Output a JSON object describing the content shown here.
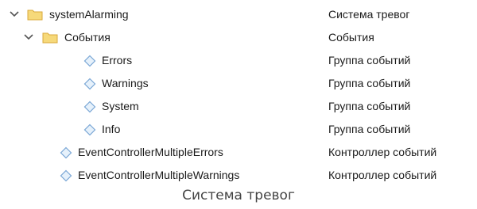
{
  "tree": {
    "root": {
      "name": "systemAlarming",
      "description": "Система тревог"
    },
    "events_folder": {
      "name": "События",
      "description": "События"
    },
    "event_groups": [
      {
        "name": "Errors",
        "description": "Группа событий"
      },
      {
        "name": "Warnings",
        "description": "Группа событий"
      },
      {
        "name": "System",
        "description": "Группа событий"
      },
      {
        "name": "Info",
        "description": "Группа событий"
      }
    ],
    "controllers": [
      {
        "name": "EventControllerMultipleErrors",
        "description": "Контроллер событий"
      },
      {
        "name": "EventControllerMultipleWarnings",
        "description": "Контроллер событий"
      }
    ]
  },
  "caption": "Система тревог",
  "colors": {
    "folder_fill": "#F6D97A",
    "folder_stroke": "#D9A93A",
    "diamond_fill": "#E6F1FB",
    "diamond_stroke": "#7AA7D6",
    "chevron": "#555555"
  },
  "icons": {
    "expand": "chevron-down-icon",
    "folder": "folder-icon",
    "node": "diamond-icon"
  }
}
